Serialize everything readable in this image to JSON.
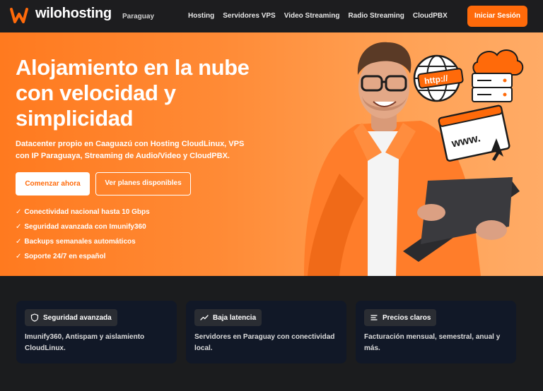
{
  "nav": {
    "brand": "wilohosting",
    "brand_sub": "Paraguay",
    "links": [
      "Hosting",
      "Servidores VPS",
      "Video Streaming",
      "Radio Streaming",
      "CloudPBX"
    ],
    "login_label": "Iniciar Sesión"
  },
  "hero": {
    "title": "Alojamiento en la nube con velocidad y simplicidad",
    "description": "Datacenter propio en Caaguazú con Hosting CloudLinux, VPS con IP Paraguaya, Streaming de Audio/Video y CloudPBX.",
    "primary_button": "Comenzar ahora",
    "secondary_button": "Ver planes disponibles",
    "features": [
      "Conectividad nacional hasta 10 Gbps",
      "Seguridad avanzada con Imunify360",
      "Backups semanales automáticos",
      "Soporte 24/7 en español"
    ],
    "check_glyph": "✓",
    "art_labels": {
      "http": "http://",
      "www": "www."
    }
  },
  "cards": [
    {
      "icon": "shield-icon",
      "title": "Seguridad avanzada",
      "description": "Imunify360, Antispam y aislamiento CloudLinux."
    },
    {
      "icon": "trend-icon",
      "title": "Baja latencia",
      "description": "Servidores en Paraguay con conectividad local."
    },
    {
      "icon": "list-icon",
      "title": "Precios claros",
      "description": "Facturación mensual, semestral, anual y más."
    }
  ],
  "colors": {
    "accent": "#ff6a0a",
    "card_bg": "#111827",
    "page_bg": "#1b1c1e"
  }
}
